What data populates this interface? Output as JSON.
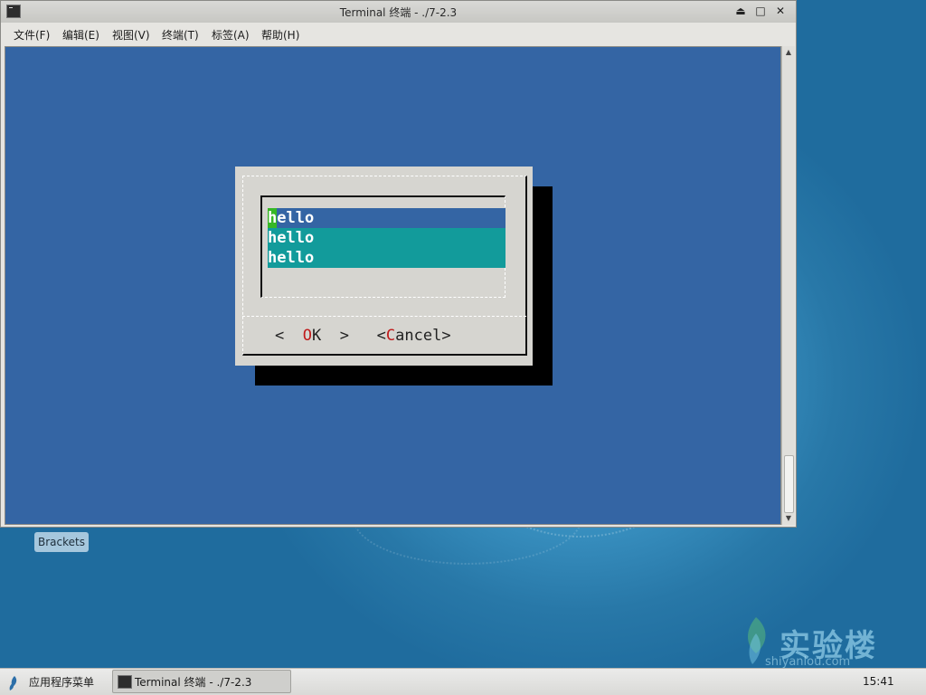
{
  "window": {
    "title": "Terminal 终端 - ./7-2.3",
    "buttons": {
      "shade": "⏏",
      "maximize": "□",
      "close": "✕"
    }
  },
  "menubar": {
    "items": [
      {
        "label": "文件(F)"
      },
      {
        "label": "编辑(E)"
      },
      {
        "label": "视图(V)"
      },
      {
        "label": "终端(T)"
      },
      {
        "label": "标签(A)"
      },
      {
        "label": "帮助(H)"
      }
    ]
  },
  "terminal": {
    "background": "#3465a4",
    "dialog": {
      "list": [
        {
          "cursor_char": "h",
          "rest": "ello",
          "selected": true
        },
        {
          "text": "hello"
        },
        {
          "text": "hello"
        }
      ],
      "ok_button": {
        "left": "<  ",
        "hot": "O",
        "rest": "K",
        "right": "  >"
      },
      "cancel_button": {
        "left": "<",
        "hot": "C",
        "rest": "ancel",
        "right": ">"
      }
    }
  },
  "desktop": {
    "icon_label": "Brackets",
    "watermark": {
      "main": "实验楼",
      "sub": "shiyanlou.com"
    }
  },
  "taskbar": {
    "app_menu_label": "应用程序菜单",
    "task_label": "Terminal 终端 - ./7-2.3",
    "clock": "15:41"
  }
}
